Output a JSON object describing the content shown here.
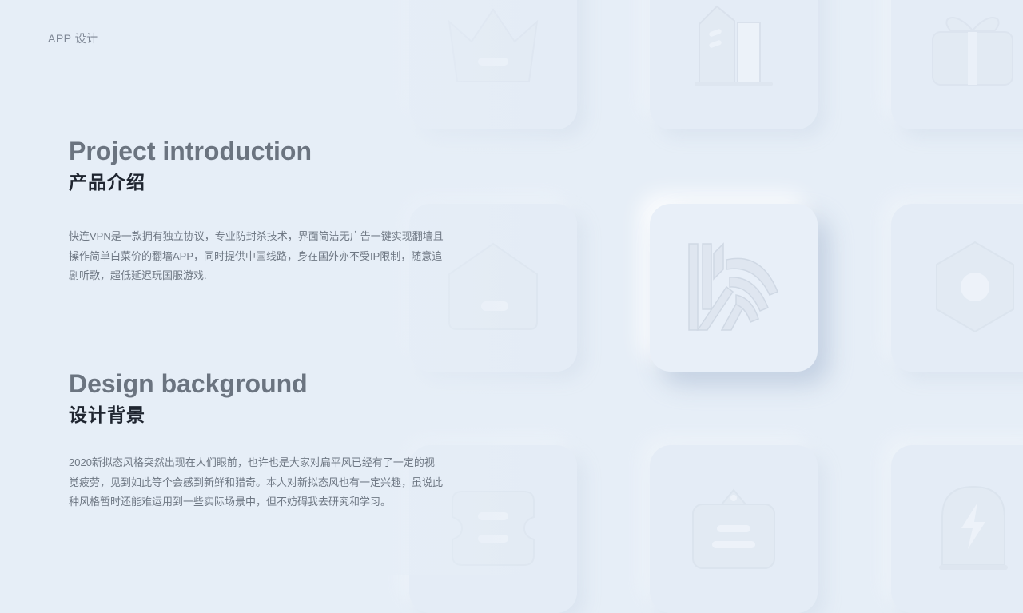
{
  "header": {
    "label": "APP 设计"
  },
  "intro": {
    "title_en": "Project introduction",
    "title_cn": "产品介绍",
    "description": "快连VPN是一款拥有独立协议，专业防封杀技术，界面简洁无广告一键实现翻墙且操作简单白菜价的翻墙APP，同时提供中国线路，身在国外亦不受IP限制，随意追剧听歌，超低延迟玩国服游戏."
  },
  "background": {
    "title_en": "Design background",
    "title_cn": "设计背景",
    "description": "2020新拟态风格突然出现在人们眼前，也许也是大家对扁平风已经有了一定的视觉疲劳，见到如此等个会感到新鲜和猎奇。本人对新拟态风也有一定兴趣，虽说此种风格暂时还能难运用到一些实际场景中，但不妨碍我去研究和学习。"
  },
  "icons": {
    "top_left": "crown-icon",
    "top_center": "building-icon",
    "top_right": "gift-icon",
    "middle_left": "home-icon",
    "middle_center": "app-logo-icon",
    "middle_right": "settings-hex-icon",
    "bottom_left": "ticket-icon",
    "bottom_center": "tag-icon",
    "bottom_right": "lightning-badge-icon"
  },
  "colors": {
    "background": "#e6eef7",
    "title_en": "#6b7480",
    "title_cn": "#1f2530",
    "body_text": "#6f7884"
  }
}
